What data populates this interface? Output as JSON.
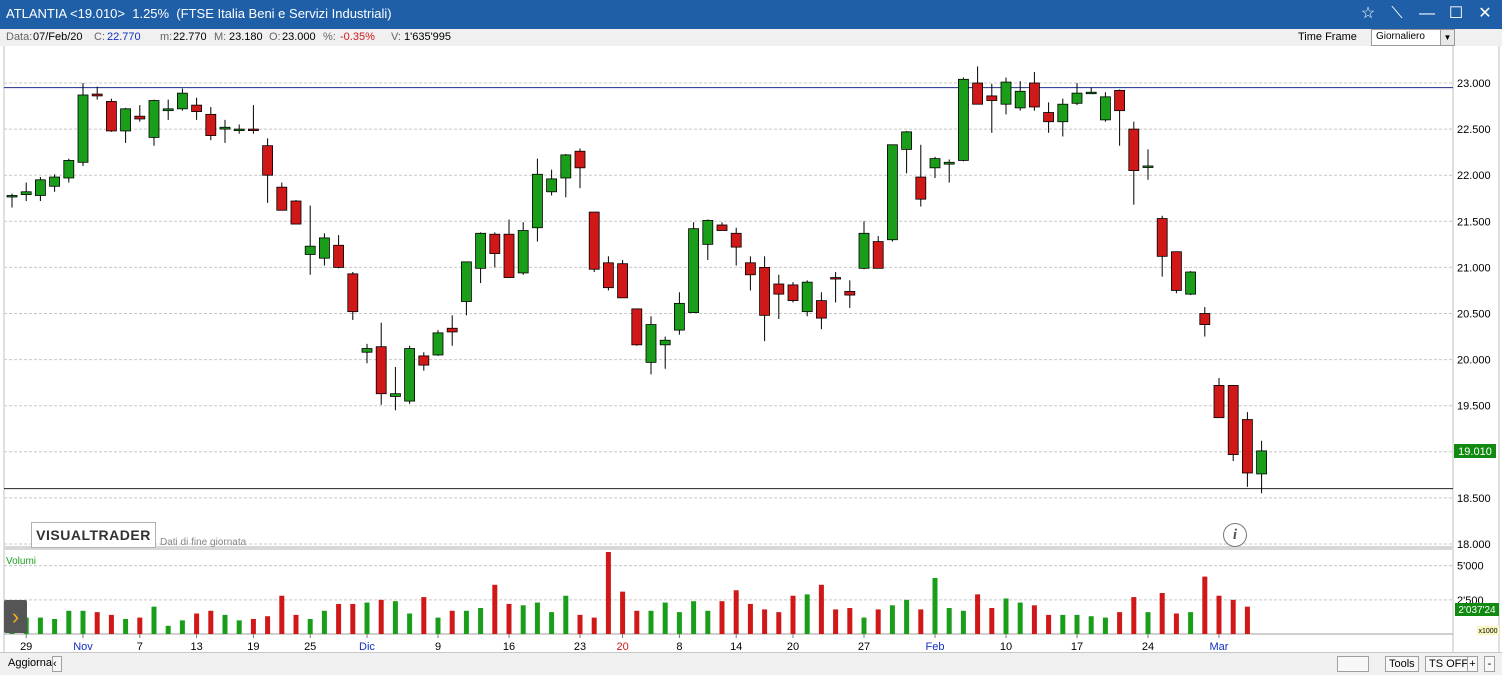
{
  "window": {
    "title": "ATLANTIA <19.010>  1.25%  (FTSE Italia Beni e Servizi Industriali)",
    "buttons": {
      "favorite": "☆",
      "pin": "⟍",
      "minimize": "—",
      "maximize": "☐",
      "close": "✕"
    }
  },
  "infobar": {
    "date_label": "Data:",
    "date_value": "07/Feb/20",
    "close_label": "C:",
    "close_value": "22.770",
    "low_label": "m:",
    "low_value": "22.770",
    "high_label": "M:",
    "high_value": "23.180",
    "open_label": "O:",
    "open_value": "23.000",
    "pct_label": "%:",
    "pct_value": "-0.35%",
    "vol_label": "V:",
    "vol_value": "1'635'995",
    "timeframe_label": "Time Frame",
    "timeframe_value": "Giornaliero"
  },
  "branding": {
    "logo": "VISUALTRADER",
    "subtitle": "Dati di fine giornata"
  },
  "statusbar": {
    "refresh": "Aggiorna",
    "tools": "Tools",
    "ts_off": "TS OFF",
    "plus": "+",
    "minus": "-"
  },
  "colors": {
    "up": "#1a9e1a",
    "down": "#d01818",
    "level_line": "#1e2e8a",
    "support_line": "#222222",
    "price_tag": "#108a10"
  },
  "chart_data": {
    "type": "candlestick",
    "ylim": [
      18.0,
      23.2
    ],
    "yticks": [
      "23.000",
      "22.500",
      "22.000",
      "21.500",
      "21.000",
      "20.500",
      "20.000",
      "19.500",
      "19.000",
      "18.500",
      "18.000"
    ],
    "last_price_label": "19.010",
    "horizontal_lines": [
      22.95,
      18.6
    ],
    "x_labels": [
      {
        "i": 1,
        "text": "29"
      },
      {
        "i": 5,
        "text": "Nov",
        "month": true
      },
      {
        "i": 9,
        "text": "7"
      },
      {
        "i": 13,
        "text": "13"
      },
      {
        "i": 17,
        "text": "19"
      },
      {
        "i": 21,
        "text": "25"
      },
      {
        "i": 25,
        "text": "Dic",
        "month": true
      },
      {
        "i": 30,
        "text": "9"
      },
      {
        "i": 35,
        "text": "16"
      },
      {
        "i": 40,
        "text": "23"
      },
      {
        "i": 43,
        "text": "20",
        "holiday": true
      },
      {
        "i": 47,
        "text": "8"
      },
      {
        "i": 51,
        "text": "14"
      },
      {
        "i": 55,
        "text": "20"
      },
      {
        "i": 60,
        "text": "27"
      },
      {
        "i": 65,
        "text": "Feb",
        "month": true
      },
      {
        "i": 70,
        "text": "10"
      },
      {
        "i": 75,
        "text": "17"
      },
      {
        "i": 80,
        "text": "24"
      },
      {
        "i": 85,
        "text": "Mar",
        "month": true
      }
    ],
    "candles": [
      [
        21.78,
        21.8,
        21.65,
        21.78
      ],
      [
        21.79,
        21.92,
        21.72,
        21.82
      ],
      [
        21.78,
        21.98,
        21.72,
        21.95
      ],
      [
        21.88,
        22.01,
        21.82,
        21.98
      ],
      [
        21.97,
        22.18,
        21.92,
        22.16
      ],
      [
        22.14,
        23.0,
        22.1,
        22.87
      ],
      [
        22.88,
        22.96,
        22.82,
        22.86
      ],
      [
        22.8,
        22.83,
        22.47,
        22.48
      ],
      [
        22.48,
        22.73,
        22.35,
        22.72
      ],
      [
        22.64,
        22.76,
        22.58,
        22.61
      ],
      [
        22.41,
        22.82,
        22.32,
        22.81
      ],
      [
        22.7,
        22.82,
        22.6,
        22.72
      ],
      [
        22.72,
        22.94,
        22.7,
        22.89
      ],
      [
        22.76,
        22.84,
        22.6,
        22.69
      ],
      [
        22.66,
        22.74,
        22.38,
        22.43
      ],
      [
        22.5,
        22.6,
        22.35,
        22.52
      ],
      [
        22.5,
        22.55,
        22.45,
        22.5
      ],
      [
        22.5,
        22.76,
        22.45,
        22.49
      ],
      [
        22.32,
        22.4,
        21.7,
        22.0
      ],
      [
        21.87,
        21.92,
        21.62,
        21.62
      ],
      [
        21.72,
        21.73,
        21.47,
        21.47
      ],
      [
        21.14,
        21.67,
        20.92,
        21.23
      ],
      [
        21.1,
        21.37,
        21.02,
        21.32
      ],
      [
        21.24,
        21.35,
        20.99,
        21.0
      ],
      [
        20.93,
        20.95,
        20.43,
        20.52
      ],
      [
        20.08,
        20.17,
        19.96,
        20.12
      ],
      [
        20.14,
        20.4,
        19.51,
        19.63
      ],
      [
        19.6,
        19.92,
        19.45,
        19.63
      ],
      [
        19.55,
        20.15,
        19.52,
        20.12
      ],
      [
        20.04,
        20.08,
        19.88,
        19.94
      ],
      [
        20.05,
        20.32,
        20.04,
        20.29
      ],
      [
        20.34,
        20.48,
        20.15,
        20.3
      ],
      [
        20.63,
        21.05,
        20.48,
        21.06
      ],
      [
        20.99,
        21.38,
        20.83,
        21.37
      ],
      [
        21.36,
        21.38,
        21.0,
        21.15
      ],
      [
        21.36,
        21.52,
        20.89,
        20.89
      ],
      [
        20.94,
        21.49,
        20.92,
        21.4
      ],
      [
        21.43,
        22.18,
        21.28,
        22.01
      ],
      [
        21.82,
        22.06,
        21.78,
        21.96
      ],
      [
        21.97,
        22.23,
        21.76,
        22.22
      ],
      [
        22.26,
        22.29,
        21.86,
        22.08
      ],
      [
        21.6,
        21.6,
        20.95,
        20.98
      ],
      [
        21.05,
        21.12,
        20.75,
        20.78
      ],
      [
        21.04,
        21.08,
        20.68,
        20.67
      ],
      [
        20.55,
        20.55,
        20.15,
        20.16
      ],
      [
        19.97,
        20.47,
        19.84,
        20.38
      ],
      [
        20.16,
        20.25,
        19.9,
        20.21
      ],
      [
        20.32,
        20.73,
        20.27,
        20.61
      ],
      [
        20.51,
        21.49,
        20.51,
        21.42
      ],
      [
        21.25,
        21.52,
        21.08,
        21.51
      ],
      [
        21.46,
        21.49,
        21.4,
        21.4
      ],
      [
        21.37,
        21.43,
        21.02,
        21.22
      ],
      [
        21.05,
        21.12,
        20.75,
        20.92
      ],
      [
        21.0,
        21.12,
        20.2,
        20.48
      ],
      [
        20.82,
        20.92,
        20.44,
        20.71
      ],
      [
        20.81,
        20.84,
        20.62,
        20.64
      ],
      [
        20.52,
        20.86,
        20.47,
        20.84
      ],
      [
        20.64,
        20.73,
        20.33,
        20.45
      ],
      [
        20.89,
        20.95,
        20.62,
        20.88
      ],
      [
        20.74,
        20.86,
        20.56,
        20.7
      ],
      [
        20.99,
        21.5,
        20.98,
        21.37
      ],
      [
        21.28,
        21.34,
        21.0,
        20.99
      ],
      [
        21.3,
        22.33,
        21.28,
        22.33
      ],
      [
        22.28,
        22.48,
        22.02,
        22.47
      ],
      [
        21.98,
        22.33,
        21.66,
        21.74
      ],
      [
        22.08,
        22.2,
        21.97,
        22.18
      ],
      [
        22.12,
        22.17,
        21.92,
        22.14
      ],
      [
        22.16,
        23.06,
        22.15,
        23.04
      ],
      [
        23.0,
        23.18,
        22.77,
        22.77
      ],
      [
        22.86,
        22.99,
        22.46,
        22.81
      ],
      [
        22.77,
        23.06,
        22.66,
        23.01
      ],
      [
        22.73,
        23.02,
        22.7,
        22.91
      ],
      [
        23.0,
        23.12,
        22.7,
        22.74
      ],
      [
        22.68,
        22.79,
        22.46,
        22.58
      ],
      [
        22.58,
        22.83,
        22.42,
        22.77
      ],
      [
        22.78,
        23.0,
        22.76,
        22.89
      ],
      [
        22.9,
        22.95,
        22.88,
        22.9
      ],
      [
        22.6,
        22.9,
        22.58,
        22.85
      ],
      [
        22.92,
        22.93,
        22.32,
        22.7
      ],
      [
        22.5,
        22.58,
        21.68,
        22.05
      ],
      [
        22.1,
        22.28,
        21.95,
        22.1
      ],
      [
        21.53,
        21.56,
        20.9,
        21.12
      ],
      [
        21.17,
        21.17,
        20.72,
        20.75
      ],
      [
        20.71,
        20.96,
        20.7,
        20.95
      ],
      [
        20.5,
        20.57,
        20.25,
        20.38
      ],
      [
        19.72,
        19.8,
        19.4,
        19.37
      ],
      [
        19.72,
        19.72,
        18.9,
        18.97
      ],
      [
        19.35,
        19.43,
        18.62,
        18.77
      ],
      [
        18.76,
        19.12,
        18.55,
        19.01
      ]
    ],
    "volume_axis": {
      "ticks": [
        "5'000",
        "2'500"
      ],
      "max": 6000,
      "label": "Volumi",
      "current_label": "2'037'24",
      "unit": "x1000"
    },
    "volumes": [
      1500,
      1200,
      1200,
      1100,
      1700,
      1700,
      1600,
      1400,
      1100,
      1200,
      2000,
      600,
      1000,
      1500,
      1700,
      1400,
      1000,
      1100,
      1300,
      2800,
      1400,
      1100,
      1700,
      2200,
      2200,
      2300,
      2500,
      2400,
      1500,
      2700,
      1200,
      1700,
      1700,
      1900,
      3600,
      2200,
      2100,
      2300,
      1600,
      2800,
      1400,
      1200,
      6000,
      3100,
      1700,
      1700,
      2300,
      1600,
      2400,
      1700,
      2400,
      3200,
      2200,
      1800,
      1600,
      2800,
      2900,
      3600,
      1800,
      1900,
      1200,
      1800,
      2100,
      2500,
      1800,
      4100,
      1900,
      1700,
      2900,
      1900,
      2600,
      2300,
      2100,
      1400,
      1400,
      1400,
      1300,
      1200,
      1600,
      2700,
      1600,
      3000,
      1500,
      1600,
      4200,
      2800,
      2500,
      2000
    ]
  }
}
